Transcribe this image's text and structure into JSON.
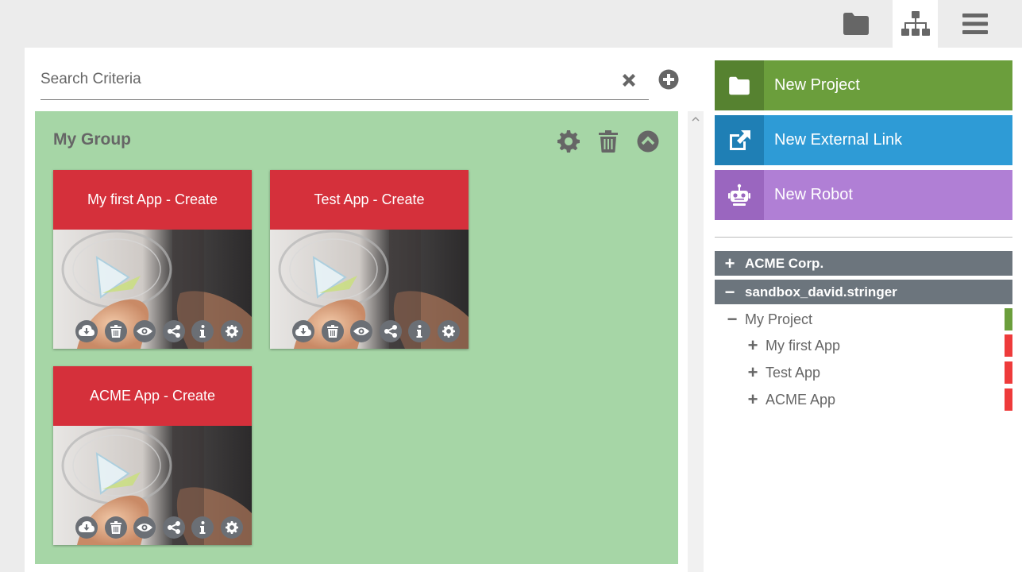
{
  "topbar": {
    "buttons": [
      {
        "icon": "folder-icon",
        "active": false
      },
      {
        "icon": "sitemap-icon",
        "active": true
      },
      {
        "icon": "menu-icon",
        "active": false
      }
    ]
  },
  "search": {
    "placeholder": "Search Criteria",
    "value": ""
  },
  "group": {
    "title": "My Group"
  },
  "cards": [
    {
      "title": "My first App - Create"
    },
    {
      "title": "Test App - Create"
    },
    {
      "title": "ACME App - Create"
    }
  ],
  "actions": {
    "new_project": "New Project",
    "new_external_link": "New External Link",
    "new_robot": "New Robot"
  },
  "tree": {
    "org": {
      "symbol": "+",
      "label": "ACME Corp."
    },
    "sandbox": {
      "symbol": "−",
      "label": "sandbox_david.stringer"
    },
    "project": {
      "symbol": "−",
      "label": "My Project"
    },
    "apps": [
      {
        "symbol": "+",
        "label": "My first App"
      },
      {
        "symbol": "+",
        "label": "Test App"
      },
      {
        "symbol": "+",
        "label": "ACME App"
      }
    ]
  },
  "colors": {
    "project": "#6b9e3c",
    "external_link": "#2e9bd6",
    "robot": "#b07fd5",
    "card_header": "#d5303b",
    "group_bg": "#a6d6a6",
    "tree_head": "#6c757d",
    "app_mark": "#ee3b3b",
    "project_mark": "#6b9e3c"
  }
}
